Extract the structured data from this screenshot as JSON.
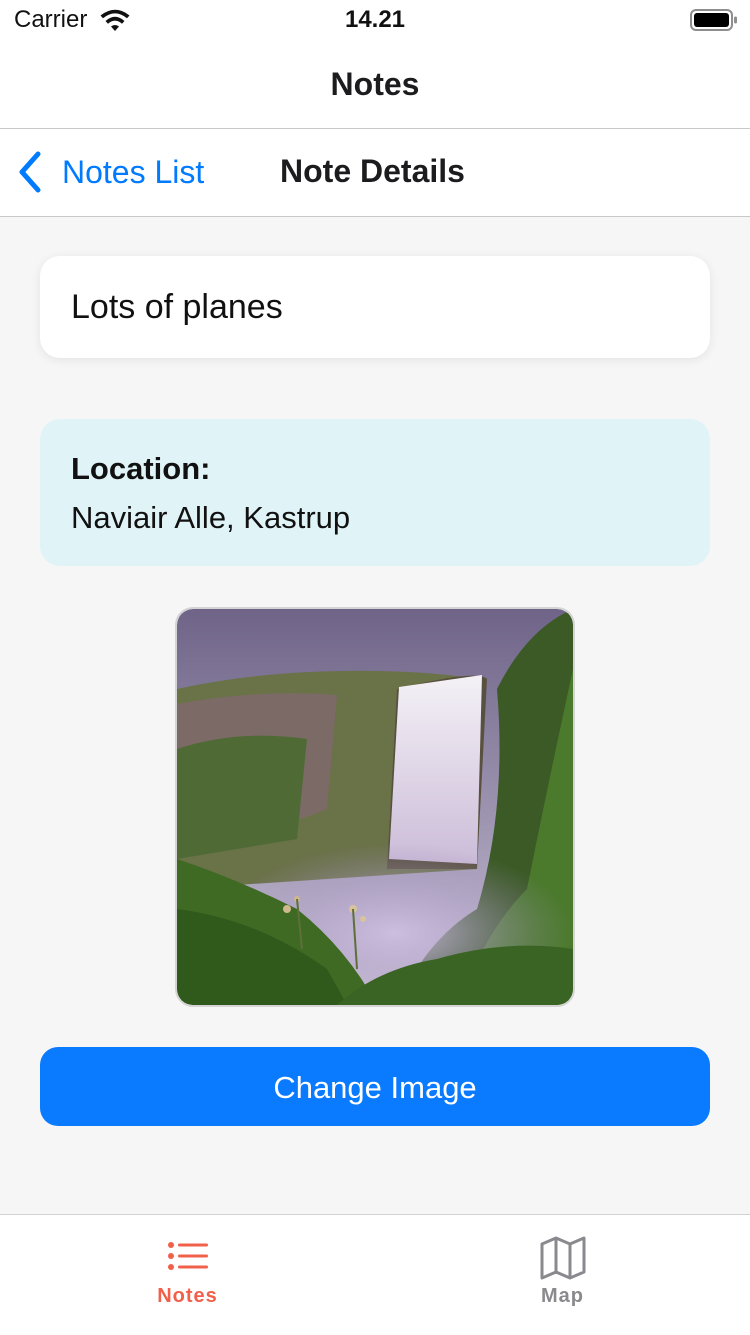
{
  "status_bar": {
    "carrier": "Carrier",
    "time": "14.21"
  },
  "app_header": {
    "title": "Notes"
  },
  "nav_bar": {
    "back_label": "Notes List",
    "title": "Note Details"
  },
  "note": {
    "title_value": "Lots of planes",
    "location_label": "Location:",
    "location_value": "Naviair Alle, Kastrup"
  },
  "actions": {
    "change_image_label": "Change Image"
  },
  "tab_bar": {
    "tabs": [
      {
        "label": "Notes",
        "icon": "list-icon",
        "selected": true
      },
      {
        "label": "Map",
        "icon": "map-icon",
        "selected": false
      }
    ]
  },
  "colors": {
    "accent": "#007aff",
    "button": "#0a7aff",
    "selected_tab": "#f0604a",
    "unselected_tab": "#8a8a8e",
    "location_card": "#e0f4f8",
    "background": "#f6f6f6"
  }
}
